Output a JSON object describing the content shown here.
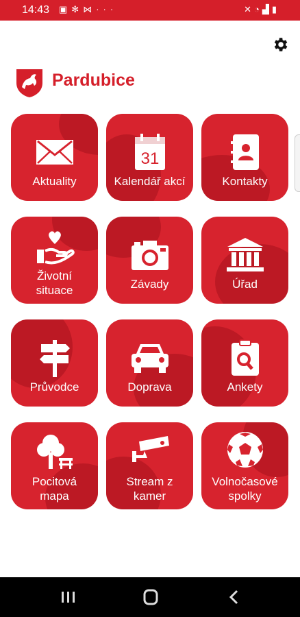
{
  "status_bar": {
    "time": "14:43",
    "left_icons": [
      "image-icon",
      "gear-icon",
      "signal-icon",
      "more-icon"
    ],
    "right_icons": [
      "mute-icon",
      "wifi-icon",
      "signal-icon",
      "battery-icon"
    ]
  },
  "header": {
    "brand": "Pardubice"
  },
  "tiles": [
    {
      "label": "Aktuality",
      "icon": "envelope-icon"
    },
    {
      "label": "Kalendář akcí",
      "icon": "calendar-icon",
      "icon_text": "31"
    },
    {
      "label": "Kontakty",
      "icon": "contacts-icon"
    },
    {
      "label": "Životní\nsituace",
      "icon": "heart-hand-icon"
    },
    {
      "label": "Závady",
      "icon": "camera-icon"
    },
    {
      "label": "Úřad",
      "icon": "institution-icon"
    },
    {
      "label": "Průvodce",
      "icon": "signpost-icon"
    },
    {
      "label": "Doprava",
      "icon": "car-icon"
    },
    {
      "label": "Ankety",
      "icon": "survey-icon"
    },
    {
      "label": "Pocitová\nmapa",
      "icon": "park-icon"
    },
    {
      "label": "Stream z\nkamer",
      "icon": "security-camera-icon"
    },
    {
      "label": "Volnočasové\nspolky",
      "icon": "soccer-ball-icon"
    }
  ],
  "colors": {
    "brand_red": "#d51f2a",
    "tile_red": "#d7232e"
  }
}
